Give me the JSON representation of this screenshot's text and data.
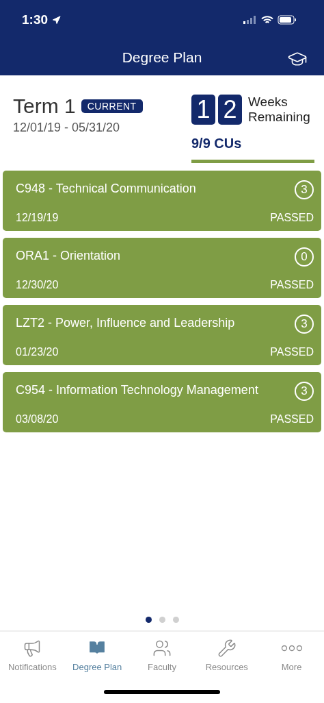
{
  "status_bar": {
    "time": "1:30"
  },
  "header": {
    "title": "Degree Plan"
  },
  "term": {
    "name": "Term 1",
    "badge": "CURRENT",
    "dates": "12/01/19 - 05/31/20",
    "weeks_digits": [
      "1",
      "2"
    ],
    "weeks_label_1": "Weeks",
    "weeks_label_2": "Remaining",
    "cus": "9/9  CUs",
    "level": 1
  },
  "courses": [
    {
      "title": "C948 - Technical Communication",
      "cus": "3",
      "date": "12/19/19",
      "status": "PASSED"
    },
    {
      "title": "ORA1 - Orientation",
      "cus": "0",
      "date": "12/30/20",
      "status": "PASSED"
    },
    {
      "title": "LZT2 - Power, Influence and Leadership",
      "cus": "3",
      "date": "01/23/20",
      "status": "PASSED"
    },
    {
      "title": "C954 - Information Technology Management",
      "cus": "3",
      "date": "03/08/20",
      "status": "PASSED"
    }
  ],
  "pages": [
    {
      "selected": true
    },
    {
      "selected": false
    },
    {
      "selected": false
    }
  ],
  "tabs": [
    {
      "kind": "notifications",
      "label": "Notifications",
      "selected": false
    },
    {
      "kind": "degree",
      "label": "Degree Plan",
      "selected": true
    },
    {
      "kind": "faculty",
      "label": "Faculty",
      "selected": false
    },
    {
      "kind": "resources",
      "label": "Resources",
      "selected": false
    },
    {
      "kind": "more",
      "label": "More",
      "selected": false
    }
  ]
}
